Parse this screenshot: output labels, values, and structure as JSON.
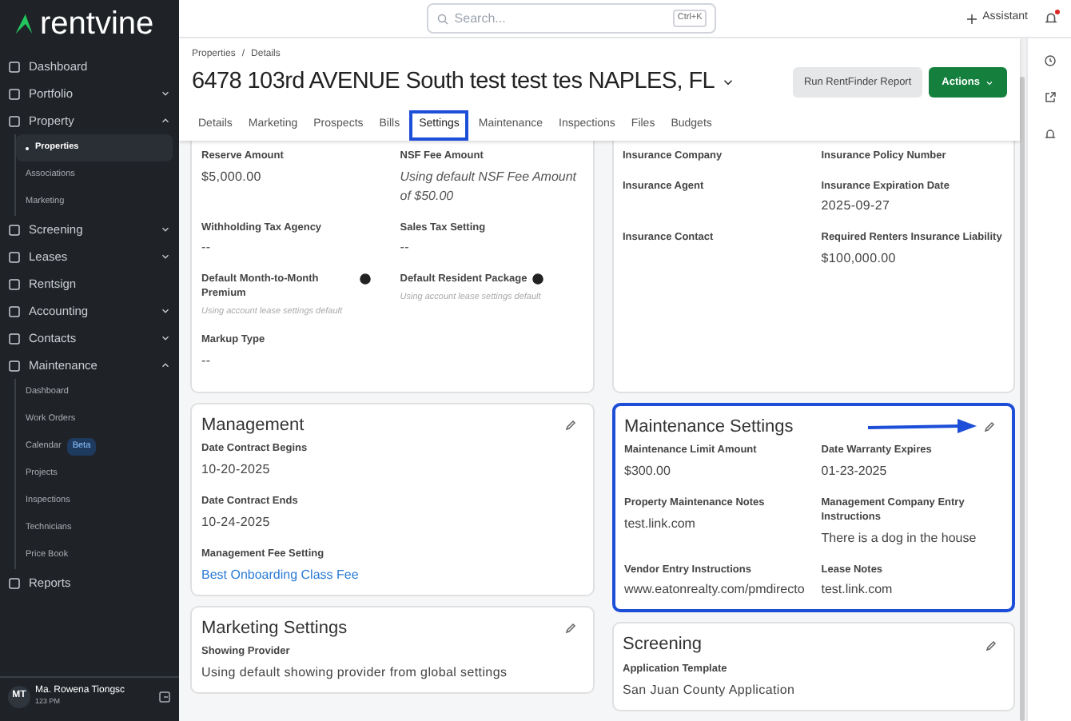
{
  "sidebar": {
    "logo": "rentvine",
    "items": [
      {
        "label": "Dashboard"
      },
      {
        "label": "Portfolio",
        "expanded": false
      },
      {
        "label": "Property",
        "expanded": true,
        "children": [
          {
            "label": "Properties",
            "selected": true
          },
          {
            "label": "Associations",
            "selected": false
          },
          {
            "label": "Marketing",
            "selected": false
          }
        ]
      },
      {
        "label": "Screening",
        "expanded": false
      },
      {
        "label": "Leases",
        "expanded": false
      },
      {
        "label": "Rentsign"
      },
      {
        "label": "Accounting",
        "expanded": false
      },
      {
        "label": "Contacts",
        "expanded": false
      },
      {
        "label": "Maintenance",
        "expanded": true,
        "children": [
          {
            "label": "Dashboard",
            "selected": false
          },
          {
            "label": "Work Orders",
            "selected": false
          },
          {
            "label": "Calendar",
            "selected": false,
            "badge": "Beta"
          },
          {
            "label": "Projects",
            "selected": false
          },
          {
            "label": "Inspections",
            "selected": false
          },
          {
            "label": "Technicians",
            "selected": false
          },
          {
            "label": "Price Book",
            "selected": false
          }
        ]
      },
      {
        "label": "Reports"
      }
    ],
    "user": {
      "initials": "MT",
      "name": "Ma. Rowena Tiongsc",
      "time": "123 PM"
    }
  },
  "topbar": {
    "search": {
      "placeholder": "Search...",
      "shortcut": "Ctrl+K"
    },
    "assistant": "Assistant",
    "notification_dot": true
  },
  "header": {
    "breadcrumbs": [
      "Properties",
      "Details"
    ],
    "breadcrumb_separator": "/",
    "title": "6478 103rd AVENUE South test test tes NAPLES, FL",
    "secondary_button": "Run RentFinder Report",
    "primary_button": "Actions",
    "tabs": [
      {
        "label": "Details",
        "selected": false
      },
      {
        "label": "Marketing",
        "selected": false
      },
      {
        "label": "Prospects",
        "selected": false
      },
      {
        "label": "Bills",
        "selected": false
      },
      {
        "label": "Settings",
        "selected": true
      },
      {
        "label": "Maintenance",
        "selected": false
      },
      {
        "label": "Inspections",
        "selected": false
      },
      {
        "label": "Files",
        "selected": false
      },
      {
        "label": "Budgets",
        "selected": false
      }
    ]
  },
  "columns": [
    [
      {
        "kind": "continued",
        "fields": [
          {
            "label": "Reserve Amount",
            "value": "$5,000.00",
            "kind": "text"
          },
          {
            "label": "NSF Fee Amount",
            "value": "Using default NSF Fee Amount of $50.00",
            "kind": "italic"
          },
          {
            "label": "Withholding Tax Agency",
            "value": "--",
            "kind": "text"
          },
          {
            "label": "Sales Tax Setting",
            "value": "--",
            "kind": "text"
          },
          {
            "label": "Default Month-to-Month Premium",
            "value": "Using account lease settings default",
            "kind": "hint",
            "info": true
          },
          {
            "label": "Default Resident Package",
            "value": "Using account lease settings default",
            "kind": "hint",
            "info": true
          },
          {
            "label": "Markup Type",
            "value": "--",
            "kind": "text"
          }
        ]
      },
      {
        "kind": "titled_list",
        "title": "Management",
        "fields": [
          {
            "label": "Date Contract Begins",
            "value": "10-20-2025",
            "kind": "text"
          },
          {
            "label": "Date Contract Ends",
            "value": "10-24-2025",
            "kind": "text"
          },
          {
            "label": "Management Fee Setting",
            "value": "Best Onboarding Class Fee",
            "kind": "link"
          }
        ]
      },
      {
        "kind": "titled_list",
        "title": "Marketing Settings",
        "fields": [
          {
            "label": "Showing Provider",
            "value": "Using default showing provider from global settings",
            "kind": "text"
          }
        ]
      }
    ],
    [
      {
        "kind": "continued",
        "fields": [
          {
            "label": "Insurance Company"
          },
          {
            "label": "Insurance Policy Number"
          },
          {
            "label": "Insurance Agent"
          },
          {
            "label": "Insurance Expiration Date",
            "value": "2025-09-27",
            "kind": "text"
          },
          {
            "label": "Insurance Contact"
          },
          {
            "label": "Required Renters Insurance Liability",
            "value": "$100,000.00",
            "kind": "text"
          }
        ]
      },
      {
        "kind": "titled_grid",
        "title": "Maintenance Settings",
        "highlighted": true,
        "fields": [
          {
            "label": "Maintenance Limit Amount",
            "value": "$300.00",
            "kind": "text"
          },
          {
            "label": "Date Warranty Expires",
            "value": "01-23-2025",
            "kind": "text"
          },
          {
            "label": "Property Maintenance Notes",
            "value": "test.link.com",
            "kind": "text"
          },
          {
            "label": "Management Company Entry Instructions",
            "value": "There is a dog in the house",
            "kind": "text"
          },
          {
            "label": "Vendor Entry Instructions",
            "value": "www.eatonrealty.com/pmdirecto",
            "kind": "text"
          },
          {
            "label": "Lease Notes",
            "value": "test.link.com",
            "kind": "text"
          }
        ]
      },
      {
        "kind": "titled_list",
        "title": "Screening",
        "fields": [
          {
            "label": "Application Template",
            "value": "San Juan County Application",
            "kind": "text"
          }
        ]
      }
    ]
  ]
}
